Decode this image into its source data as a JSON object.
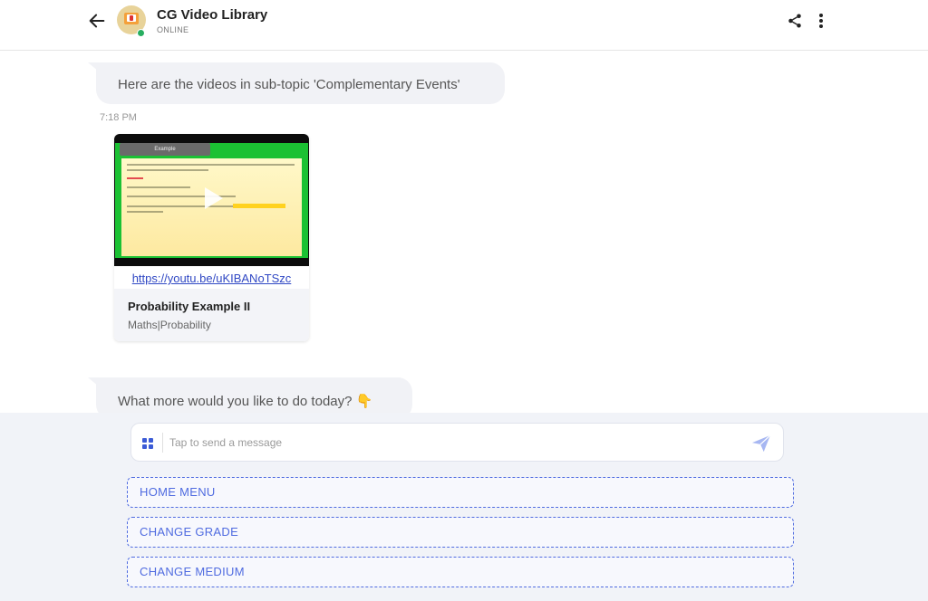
{
  "header": {
    "title": "CG Video Library",
    "status": "ONLINE",
    "back_icon": "arrow-left-icon",
    "share_icon": "share-icon",
    "more_icon": "more-vertical-icon"
  },
  "messages": {
    "intro": "Here are the videos in sub-topic 'Complementary Events'",
    "time": "7:18 PM",
    "video": {
      "link": "https://youtu.be/uKIBANoTSzc",
      "title": "Probability Example II",
      "subtitle": "Maths|Probability",
      "thumbnail_tab": "Example"
    },
    "followup": "What more would you like to do today? 👇"
  },
  "composer": {
    "placeholder": "Tap to send a message",
    "menu_icon": "grid-icon",
    "send_icon": "send-icon"
  },
  "quick_replies": [
    "HOME MENU",
    "CHANGE GRADE",
    "CHANGE MEDIUM"
  ],
  "colors": {
    "accent": "#4f6be0",
    "online": "#27ae60",
    "bubble": "#f1f2f6",
    "footer_bg": "#f1f3f8"
  }
}
